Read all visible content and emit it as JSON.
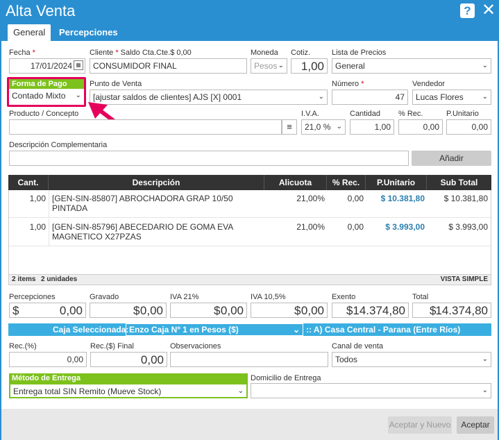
{
  "window": {
    "title": "Alta Venta",
    "help_label": "?",
    "close_label": "✕"
  },
  "tabs": [
    {
      "label": "General"
    },
    {
      "label": "Percepciones"
    }
  ],
  "header": {
    "fecha_label": "Fecha",
    "fecha_value": "17/01/2024",
    "cliente_label": "Cliente",
    "saldo_label": "Saldo Cta.Cte.$ 0,00",
    "cliente_value": "CONSUMIDOR FINAL",
    "moneda_label": "Moneda",
    "moneda_value": "Pesos",
    "cotiz_label": "Cotiz.",
    "cotiz_value": "1,00",
    "lista_label": "Lista de Precios",
    "lista_value": "General",
    "forma_pago_label": "Forma de Pago",
    "forma_pago_value": "Contado Mixto",
    "punto_venta_label": "Punto de Venta",
    "punto_venta_value": "[ajustar saldos de clientes] AJS [X] 0001",
    "numero_label": "Número",
    "numero_value": "47",
    "vendedor_label": "Vendedor",
    "vendedor_value": "Lucas Flores",
    "producto_label": "Producto / Concepto",
    "producto_value": "",
    "iva_label": "I.V.A.",
    "iva_value": "21,0 %",
    "cantidad_label": "Cantidad",
    "cantidad_value": "1,00",
    "rec_label": "% Rec.",
    "rec_value": "0,00",
    "punitario_label": "P.Unitario",
    "punitario_value": "0,00",
    "desc_comp_label": "Descripción Complementaria",
    "desc_comp_value": "",
    "anadir_label": "Añadir"
  },
  "grid": {
    "columns": [
      "Cant.",
      "Descripción",
      "Alicuota",
      "% Rec.",
      "P.Unitario",
      "Sub Total"
    ],
    "rows": [
      {
        "cant": "1,00",
        "desc": "[GEN-SIN-85807] ABROCHADORA GRAP 10/50 PINTADA",
        "alic": "21,00%",
        "rec": "0,00",
        "pu": "$ 10.381,80",
        "sub": "$ 10.381,80"
      },
      {
        "cant": "1,00",
        "desc": "[GEN-SIN-85796] ABECEDARIO DE GOMA EVA MAGNETICO X27PZAS",
        "alic": "21,00%",
        "rec": "0,00",
        "pu": "$ 3.993,00",
        "sub": "$ 3.993,00"
      }
    ],
    "items_label": "2 items",
    "units_label": "2 unidades",
    "vista_label": "VISTA SIMPLE"
  },
  "totals": {
    "percepciones_label": "Percepciones",
    "percepciones_value": "0,00",
    "gravado_label": "Gravado",
    "gravado_value": "0,00",
    "iva21_label": "IVA 21%",
    "iva21_value": "0,00",
    "iva105_label": "IVA 10,5%",
    "iva105_value": "0,00",
    "exento_label": "Exento",
    "exento_value": "14.374,80",
    "total_label": "Total",
    "total_value": "14.374,80",
    "currency": "$"
  },
  "caja": {
    "label": "Caja Seleccionada:",
    "value": "Enzo Caja Nº 1 en Pesos ($)",
    "sucursal": ":: A) Casa Central - Parana (Entre Ríos)"
  },
  "bottom": {
    "recp_label": "Rec.(%)",
    "recp_value": "0,00",
    "recf_label": "Rec.($) Final",
    "recf_value": "0,00",
    "obs_label": "Observaciones",
    "obs_value": "",
    "canal_label": "Canal de venta",
    "canal_value": "Todos",
    "metodo_label": "Método de Entrega",
    "metodo_value": "Entrega total SIN Remito (Mueve Stock)",
    "domicilio_label": "Domicilio de Entrega",
    "domicilio_value": ""
  },
  "footer": {
    "aceptar_nuevo_label": "Aceptar y Nuevo",
    "aceptar_label": "Aceptar"
  },
  "colors": {
    "accent": "#2a8fd1",
    "green": "#7dc11d",
    "highlight": "#e5005b",
    "price": "#2a7fb0",
    "caja_bar": "#3aaee0"
  }
}
